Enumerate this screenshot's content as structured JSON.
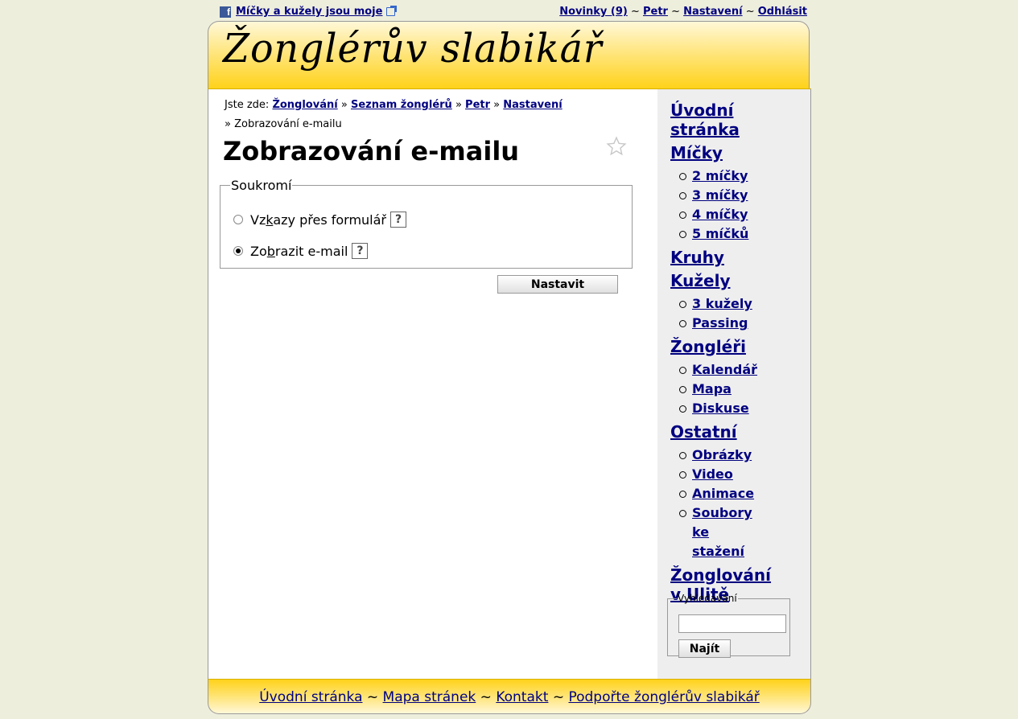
{
  "topbar": {
    "fb_link": "Míčky a kužely jsou moje",
    "news": "Novinky (9)",
    "user": "Petr",
    "settings": "Nastavení",
    "logout": "Odhlásit",
    "sep": "~"
  },
  "header": {
    "logo": "Žonglérův slabikář"
  },
  "breadcrumb": {
    "prefix": "Jste zde:",
    "items": [
      "Žonglování",
      "Seznam žonglérů",
      "Petr",
      "Nastavení"
    ],
    "sep": "»",
    "current": "» Zobrazování e-mailu"
  },
  "page": {
    "title": "Zobrazování e-mailu",
    "fieldset_legend": "Soukromí",
    "option1_a": "Vz",
    "option1_u": "k",
    "option1_b": "azy přes formulář",
    "option2_a": "Zo",
    "option2_u": "b",
    "option2_b": "razit e-mail",
    "help": "?",
    "selected_option": 2,
    "submit": "Nastavit"
  },
  "nav": {
    "home": "Úvodní stránka",
    "balls": "Míčky",
    "balls_items": [
      "2 míčky",
      "3 míčky",
      "4 míčky",
      "5 míčků"
    ],
    "rings": "Kruhy",
    "clubs": "Kužely",
    "clubs_items": [
      "3 kužely",
      "Passing"
    ],
    "jugglers": "Žongléři",
    "jugglers_items": [
      "Kalendář",
      "Mapa",
      "Diskuse"
    ],
    "other": "Ostatní",
    "other_items": [
      "Obrázky",
      "Video",
      "Animace",
      "Soubory ke stažení"
    ],
    "ulita": "Žonglování v Ulitě"
  },
  "search": {
    "legend": "Vyhledávání",
    "value": "",
    "button": "Najít"
  },
  "footer": {
    "links": [
      "Úvodní stránka",
      "Mapa stránek",
      "Kontakt",
      "Podpořte žonglérův slabikář"
    ],
    "sep": "~"
  },
  "colors": {
    "link": "#000080",
    "header_yellow": "#ffd21a",
    "background": "#eeeedd",
    "sidebar": "#eeeeee"
  },
  "icons": [
    "facebook-icon",
    "external-link-icon",
    "star-icon"
  ]
}
